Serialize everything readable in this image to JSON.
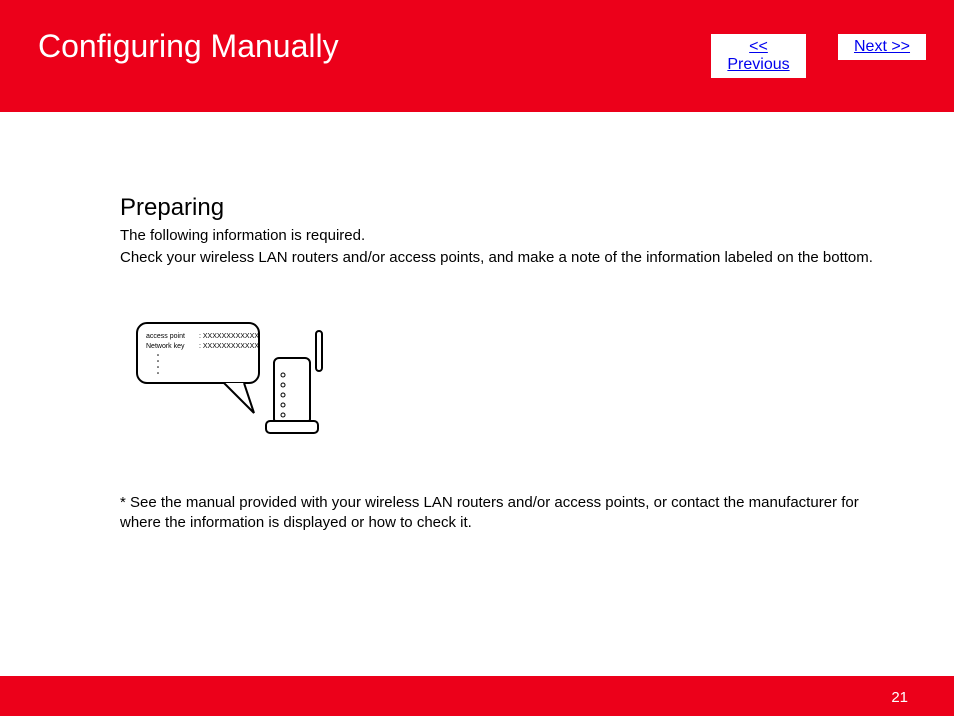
{
  "header": {
    "title": "Configuring Manually",
    "prev_label": "<< Previous",
    "next_label": "Next >>"
  },
  "body": {
    "subheading": "Preparing",
    "line1": "The following information is required.",
    "line2": "Check your wireless LAN routers and/or access points, and make a note of the information labeled on the bottom.",
    "note": "* See the manual provided with your wireless LAN routers and/or access points, or contact the manufacturer for where the information is displayed or how to check it."
  },
  "illustration": {
    "label_ap": "access point",
    "label_key": "Network key",
    "mask": ": XXXXXXXXXXXX"
  },
  "footer": {
    "page_number": "21"
  }
}
